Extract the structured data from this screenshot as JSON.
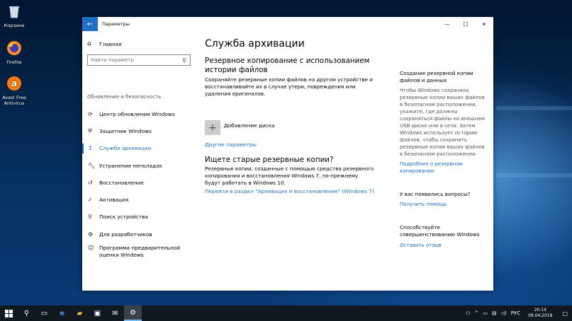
{
  "desktop": {
    "icons": [
      {
        "label": "Корзина"
      },
      {
        "label": "Firefox"
      },
      {
        "label": "Avast Free Antivirus"
      }
    ]
  },
  "window": {
    "title": "Параметры",
    "controls": {
      "minimize": "—",
      "maximize": "☐",
      "close": "✕"
    }
  },
  "nav": {
    "home": "Главная",
    "search_placeholder": "Найти параметр",
    "section_header": "Обновление и безопасность",
    "items": [
      {
        "label": "Центр обновления Windows",
        "icon": "refresh-icon"
      },
      {
        "label": "Защитник Windows",
        "icon": "shield-icon"
      },
      {
        "label": "Служба архивации",
        "icon": "backup-icon",
        "selected": true
      },
      {
        "label": "Устранение неполадок",
        "icon": "wrench-icon"
      },
      {
        "label": "Восстановление",
        "icon": "history-icon"
      },
      {
        "label": "Активация",
        "icon": "check-circle-icon"
      },
      {
        "label": "Поиск устройства",
        "icon": "person-pin-icon"
      },
      {
        "label": "Для разработчиков",
        "icon": "developer-icon"
      },
      {
        "label": "Программа предварительной оценки Windows",
        "icon": "insider-icon"
      }
    ]
  },
  "main": {
    "title": "Служба архивации",
    "file_history": {
      "heading": "Резервное копирование с использованием истории файлов",
      "text": "Сохраняйте резервные копии файлов на другом устройстве и восстанавливайте их в случае утери, повреждения или удаления оригиналов.",
      "add_drive": "Добавление диска",
      "more_options": "Другие параметры"
    },
    "old_backup": {
      "heading": "Ищете старые резервные копии?",
      "text": "Резервные копии, созданные с помощью средства резервного копирования и восстановления Windows 7, по-прежнему будут работать в Windows 10.",
      "link": "Перейти в раздел \"Архивация и восстановление\" (Windows 7)"
    }
  },
  "aside": {
    "backup_heading": "Создание резервной копии файлов и данных",
    "backup_text": "Чтобы Windows сохраняла резервные копии ваших файлов в безопасном расположении, укажите, где должны сохраняться файлы на внешнем USB-диске или в сети. Затем Windows использует историю файлов, чтобы сохранить резервные копии ваших файлов в безопасном расположении.",
    "backup_link": "Подробнее о резервном копировании",
    "questions_heading": "У вас появились вопросы?",
    "help_link": "Получить помощь",
    "improve_heading": "Способствуйте совершенствованию Windows",
    "feedback_link": "Оставить отзыв"
  },
  "taskbar": {
    "language": "РУС",
    "time": "20:14",
    "date": "09.04.2018"
  },
  "colors": {
    "accent": "#1f6fc4",
    "taskbar": "#101820"
  }
}
